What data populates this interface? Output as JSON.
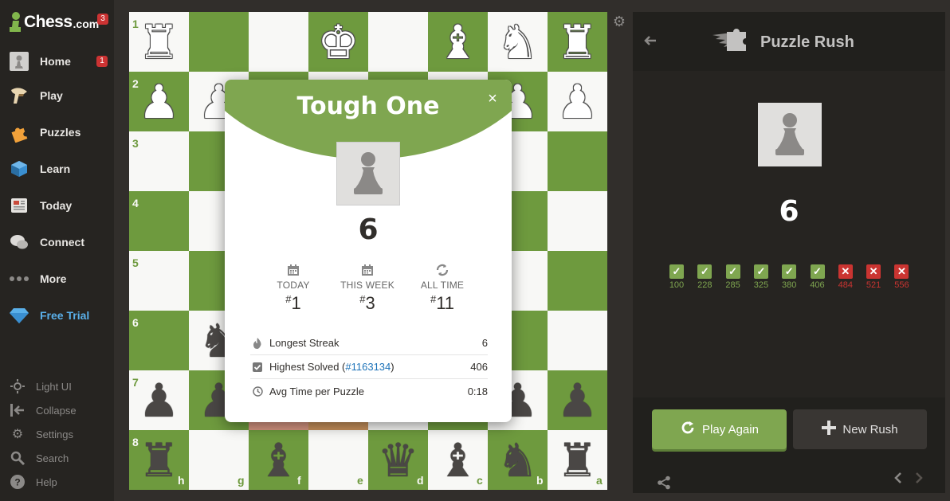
{
  "sidebar": {
    "logo": {
      "name": "Chess",
      "suffix": ".com",
      "badge": "3"
    },
    "items": [
      {
        "label": "Home",
        "badge": "1",
        "icon": "home-avatar-icon"
      },
      {
        "label": "Play",
        "icon": "play-hand-icon"
      },
      {
        "label": "Puzzles",
        "icon": "puzzle-piece-icon"
      },
      {
        "label": "Learn",
        "icon": "learn-cube-icon"
      },
      {
        "label": "Today",
        "icon": "newspaper-icon"
      },
      {
        "label": "Connect",
        "icon": "chat-bubbles-icon"
      },
      {
        "label": "More",
        "icon": "dots-icon"
      },
      {
        "label": "Free Trial",
        "icon": "diamond-icon"
      }
    ],
    "bottom": [
      {
        "label": "Light UI",
        "icon": "sun-icon"
      },
      {
        "label": "Collapse",
        "icon": "collapse-icon"
      },
      {
        "label": "Settings",
        "icon": "gear-icon"
      },
      {
        "label": "Search",
        "icon": "search-icon"
      },
      {
        "label": "Help",
        "icon": "help-icon"
      }
    ]
  },
  "board": {
    "ranks": [
      "1",
      "2",
      "3",
      "4",
      "5",
      "6",
      "7",
      "8"
    ],
    "files": [
      "h",
      "g",
      "f",
      "e",
      "d",
      "c",
      "b",
      "a"
    ]
  },
  "modal": {
    "title": "Tough One",
    "close": "×",
    "score": "6",
    "ranks": [
      {
        "label": "TODAY",
        "value": "1",
        "icon": "calendar-icon"
      },
      {
        "label": "THIS WEEK",
        "value": "3",
        "icon": "calendar-icon"
      },
      {
        "label": "ALL TIME",
        "value": "11",
        "icon": "refresh-icon"
      }
    ],
    "hash": "#",
    "stats": [
      {
        "label": "Longest Streak",
        "value": "6",
        "icon": "flame-icon"
      },
      {
        "label": "Highest Solved (",
        "link": "#1163134",
        "label_end": ")",
        "value": "406",
        "icon": "checkbox-icon"
      },
      {
        "label": "Avg Time per Puzzle",
        "value": "0:18",
        "icon": "clock-icon"
      }
    ]
  },
  "panel": {
    "title": "Puzzle Rush",
    "score": "6",
    "results": [
      {
        "n": "100",
        "ok": true
      },
      {
        "n": "228",
        "ok": true
      },
      {
        "n": "285",
        "ok": true
      },
      {
        "n": "325",
        "ok": true
      },
      {
        "n": "380",
        "ok": true
      },
      {
        "n": "406",
        "ok": true
      },
      {
        "n": "484",
        "ok": false
      },
      {
        "n": "521",
        "ok": false
      },
      {
        "n": "556",
        "ok": false
      }
    ],
    "play_again": "Play Again",
    "new_rush": "New Rush"
  },
  "colors": {
    "board_light": "#f8f8f6",
    "board_dark": "#6e9a3e",
    "accent_green": "#7fa650",
    "error_red": "#ca3431",
    "link_blue": "#1c72b8"
  }
}
